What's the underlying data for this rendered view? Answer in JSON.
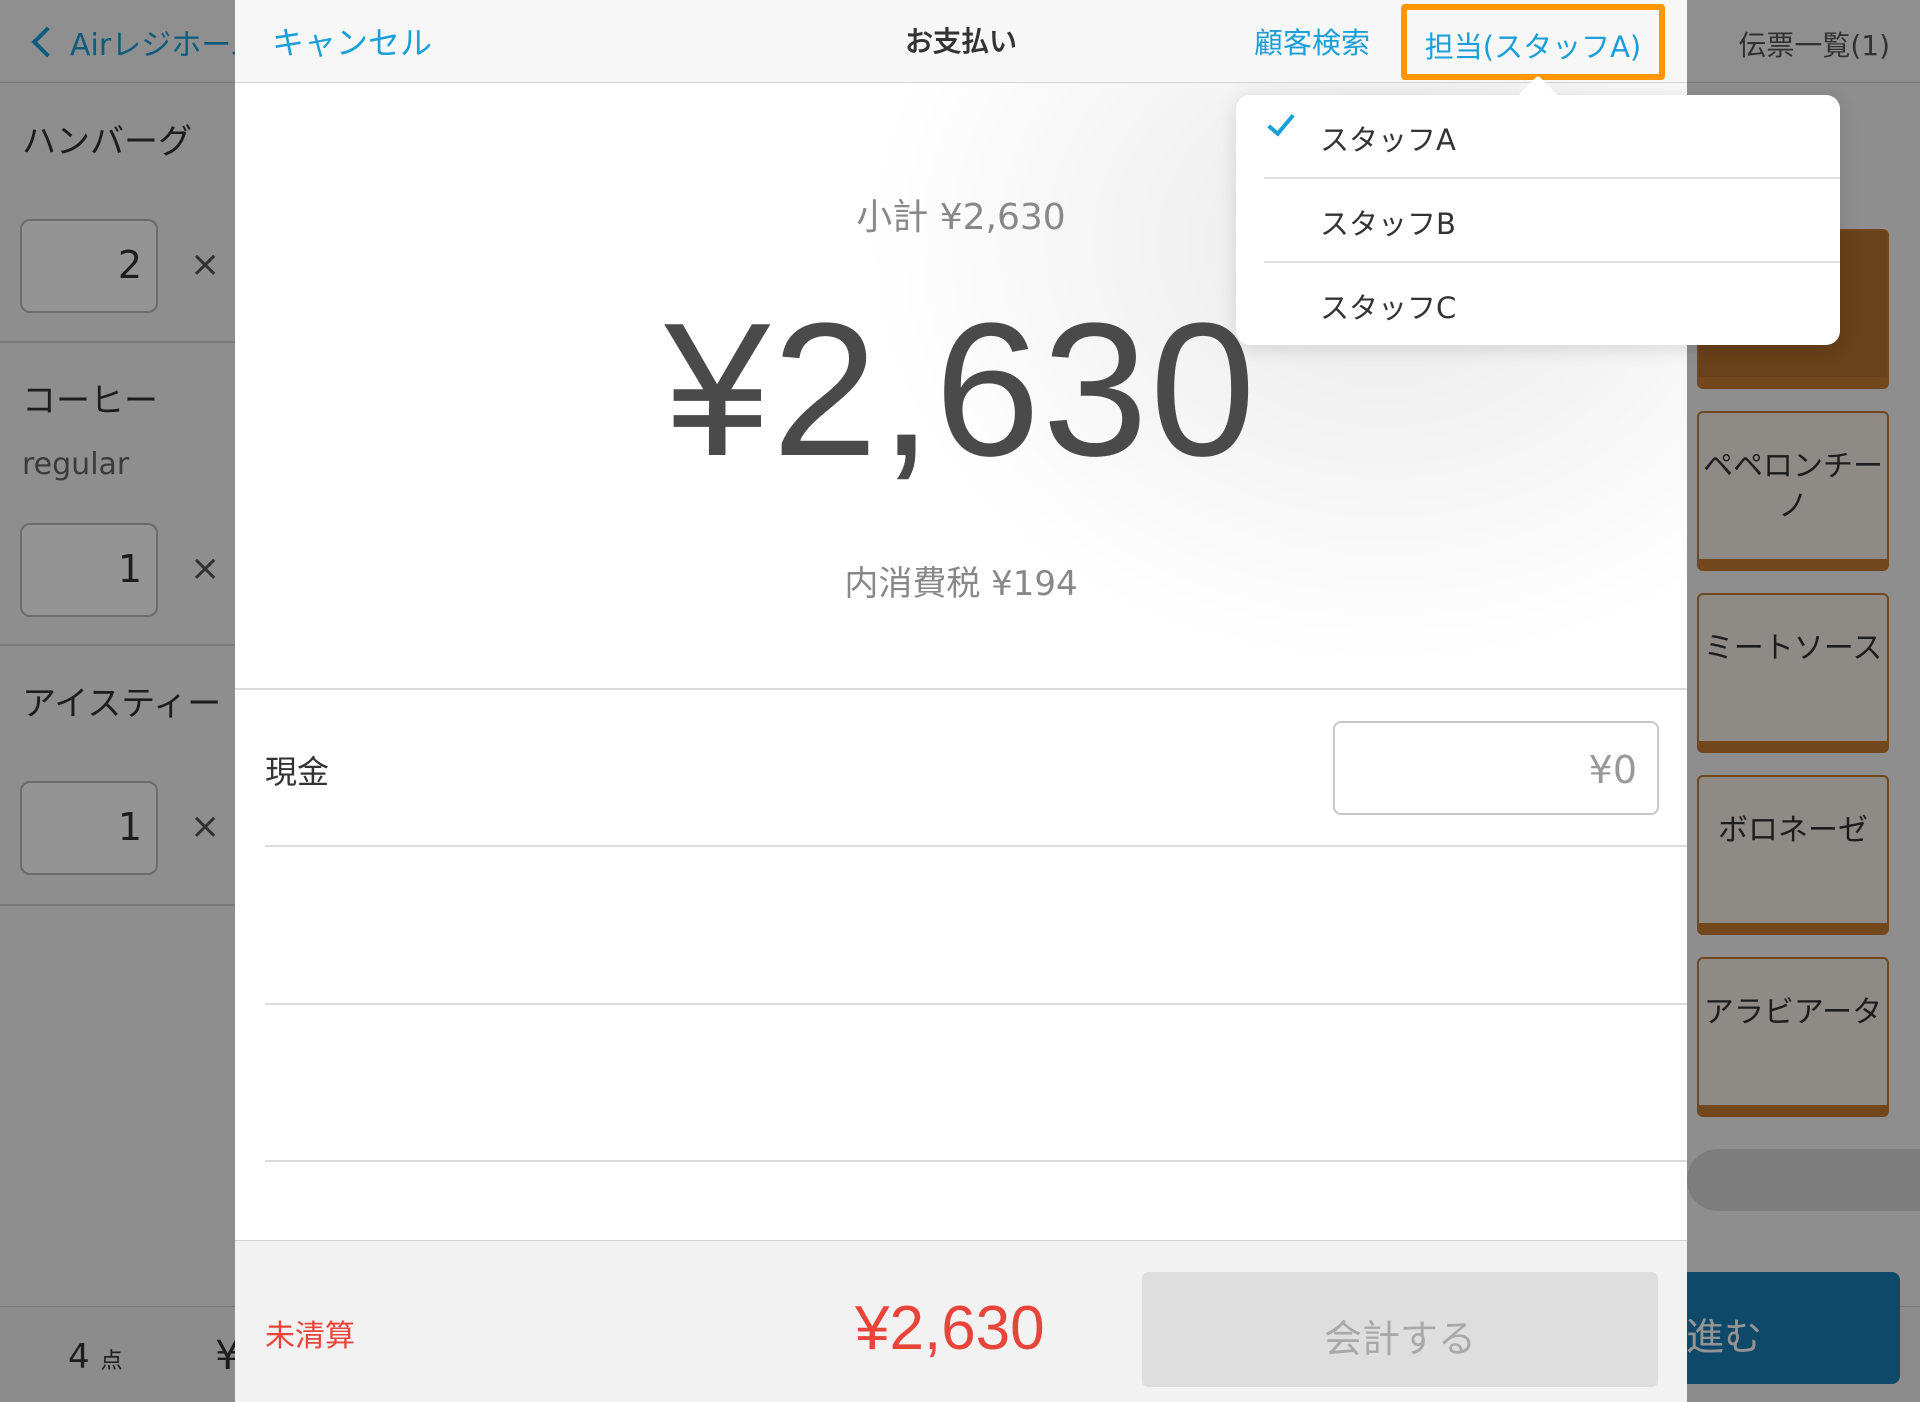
{
  "background": {
    "back_label": "Airレジホーム",
    "slip_list": "伝票一覧(1)",
    "order_items": [
      {
        "name": "ハンバーグ",
        "sub": "",
        "qty": "2"
      },
      {
        "name": "コーヒー",
        "sub": "regular",
        "qty": "1"
      },
      {
        "name": "アイスティー",
        "sub": "",
        "qty": "1"
      }
    ],
    "times_symbol": "×",
    "menu_tiles": [
      "",
      "ペペロンチーノ",
      "ミートソース",
      "ボロネーゼ",
      "アラビアータ"
    ],
    "item_count": "4",
    "item_count_unit": "点",
    "total_prefix": "¥",
    "proceed_label": "進む"
  },
  "modal": {
    "cancel_label": "キャンセル",
    "title": "お支払い",
    "customer_search_label": "顧客検索",
    "staff_button_label": "担当(スタッフA)",
    "subtotal_text": "小計 ¥2,630",
    "total_amount": "¥2,630",
    "tax_text": "内消費税 ¥194",
    "payment_method_label": "現金",
    "cash_input_placeholder": "¥0",
    "status_text": "未清算",
    "footer_total": "¥2,630",
    "checkout_label": "会計する"
  },
  "staff_menu": {
    "items": [
      {
        "label": "スタッフA",
        "selected": true
      },
      {
        "label": "スタッフB",
        "selected": false
      },
      {
        "label": "スタッフC",
        "selected": false
      }
    ]
  },
  "colors": {
    "accent_blue": "#1a9fd8",
    "highlight_orange": "#ff9600",
    "alert_red": "#e8443a",
    "tile_brown": "#c47a2f"
  }
}
